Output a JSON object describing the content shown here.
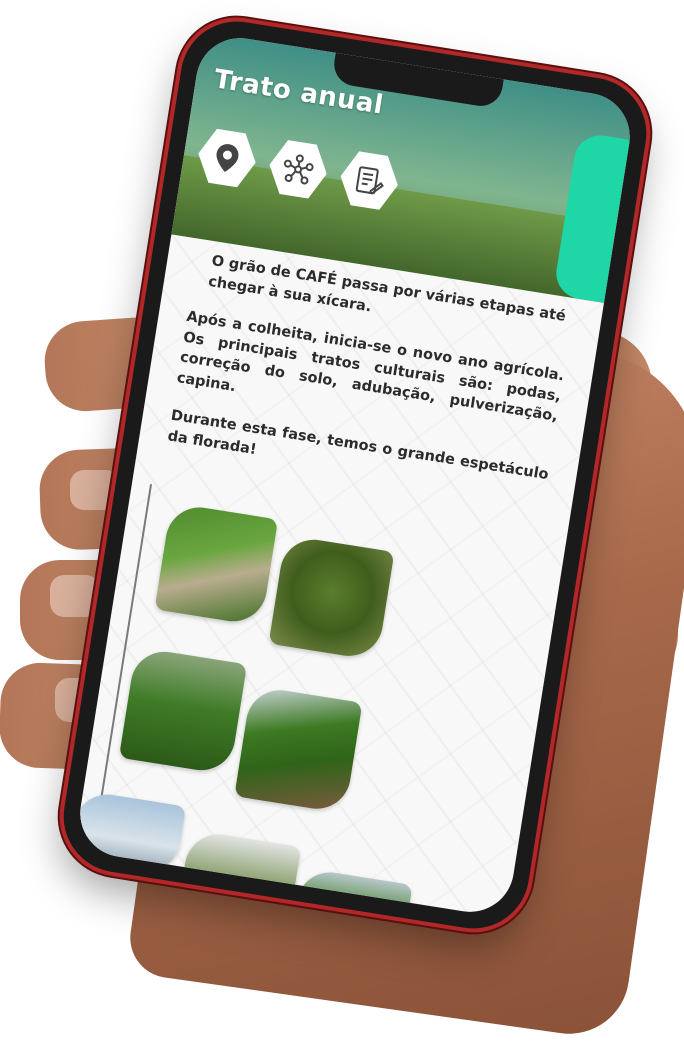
{
  "app": {
    "title": "Trato anual",
    "icons": [
      "location-pin-icon",
      "network-nodes-icon",
      "notes-edit-icon"
    ],
    "paragraphs": [
      "O grão de CAFÉ passa por várias etapas até chegar à sua xícara.",
      "Após a colheita, inicia-se o novo ano agrícola. Os principais tratos culturais são: podas, correção do solo, adubação, pulverização, capina.",
      "Durante esta fase, temos o grande espetáculo da florada!"
    ],
    "photos": [
      "coffee-rows-path",
      "coffee-tree-pruning",
      "worker-weeding",
      "coffee-rows-road",
      "landscape-sky",
      "worker-field",
      "green-field"
    ]
  },
  "colors": {
    "accent": "#1fd6a6",
    "phone_frame": "#b22828",
    "text": "#2b2b2b"
  }
}
